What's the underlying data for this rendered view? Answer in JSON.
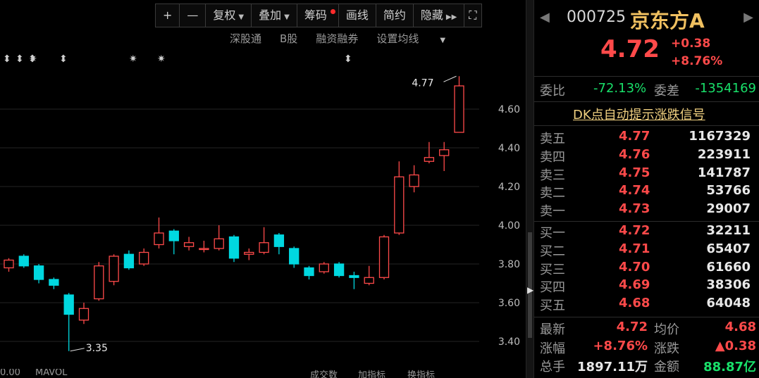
{
  "toolbar": {
    "items": [
      "+",
      "—",
      "复权",
      "叠加",
      "筹码",
      "画线",
      "简约",
      "隐藏"
    ],
    "expand_icon": "expand-icon"
  },
  "subbar": [
    "深股通",
    "B股",
    "融资融券",
    "设置均线"
  ],
  "chart_data": {
    "type": "candlestick",
    "y_ticks": [
      "4.60",
      "4.40",
      "4.20",
      "4.00",
      "3.80",
      "3.60",
      "3.40"
    ],
    "ylim": [
      3.3,
      4.8
    ],
    "candles": [
      {
        "o": 3.78,
        "c": 3.82,
        "h": 3.83,
        "l": 3.76
      },
      {
        "o": 3.84,
        "c": 3.79,
        "h": 3.85,
        "l": 3.78
      },
      {
        "o": 3.79,
        "c": 3.72,
        "h": 3.8,
        "l": 3.7
      },
      {
        "o": 3.72,
        "c": 3.69,
        "h": 3.73,
        "l": 3.67
      },
      {
        "o": 3.64,
        "c": 3.54,
        "h": 3.65,
        "l": 3.35
      },
      {
        "o": 3.51,
        "c": 3.57,
        "h": 3.6,
        "l": 3.49
      },
      {
        "o": 3.62,
        "c": 3.79,
        "h": 3.81,
        "l": 3.61
      },
      {
        "o": 3.71,
        "c": 3.84,
        "h": 3.85,
        "l": 3.69
      },
      {
        "o": 3.85,
        "c": 3.78,
        "h": 3.87,
        "l": 3.77
      },
      {
        "o": 3.8,
        "c": 3.86,
        "h": 3.88,
        "l": 3.79
      },
      {
        "o": 3.9,
        "c": 3.96,
        "h": 4.04,
        "l": 3.88
      },
      {
        "o": 3.97,
        "c": 3.92,
        "h": 3.98,
        "l": 3.85
      },
      {
        "o": 3.89,
        "c": 3.91,
        "h": 3.94,
        "l": 3.87
      },
      {
        "o": 3.88,
        "c": 3.88,
        "h": 3.92,
        "l": 3.86
      },
      {
        "o": 3.88,
        "c": 3.93,
        "h": 4.0,
        "l": 3.87
      },
      {
        "o": 3.94,
        "c": 3.83,
        "h": 3.95,
        "l": 3.81
      },
      {
        "o": 3.85,
        "c": 3.86,
        "h": 3.88,
        "l": 3.82
      },
      {
        "o": 3.86,
        "c": 3.91,
        "h": 3.99,
        "l": 3.85
      },
      {
        "o": 3.95,
        "c": 3.89,
        "h": 3.96,
        "l": 3.85
      },
      {
        "o": 3.88,
        "c": 3.8,
        "h": 3.89,
        "l": 3.78
      },
      {
        "o": 3.78,
        "c": 3.74,
        "h": 3.79,
        "l": 3.72
      },
      {
        "o": 3.76,
        "c": 3.8,
        "h": 3.81,
        "l": 3.75
      },
      {
        "o": 3.8,
        "c": 3.74,
        "h": 3.81,
        "l": 3.73
      },
      {
        "o": 3.74,
        "c": 3.73,
        "h": 3.76,
        "l": 3.67
      },
      {
        "o": 3.7,
        "c": 3.73,
        "h": 3.79,
        "l": 3.69
      },
      {
        "o": 3.73,
        "c": 3.94,
        "h": 3.95,
        "l": 3.72
      },
      {
        "o": 3.96,
        "c": 4.25,
        "h": 4.33,
        "l": 3.95
      },
      {
        "o": 4.2,
        "c": 4.26,
        "h": 4.31,
        "l": 4.17
      },
      {
        "o": 4.33,
        "c": 4.35,
        "h": 4.43,
        "l": 4.32
      },
      {
        "o": 4.36,
        "c": 4.39,
        "h": 4.43,
        "l": 4.28
      },
      {
        "o": 4.48,
        "c": 4.72,
        "h": 4.77,
        "l": 4.48
      }
    ],
    "high_label": "4.77",
    "low_label": "3.35",
    "colors": {
      "up": "#ff4a4a",
      "down": "#00d8e0",
      "grid": "#232323"
    }
  },
  "event_marks": [
    "⬍",
    "⬍",
    "⬍",
    "✷",
    "⬍",
    "✷",
    "✷",
    "⬍"
  ],
  "bottom_strip": [
    "0.00",
    "MAVOL",
    "成交数",
    "加指标",
    "换指标"
  ],
  "quote": {
    "code": "000725",
    "name": "京东方A",
    "price": "4.72",
    "change": "+0.38",
    "change_pct": "+8.76%",
    "ratio_label": "委比",
    "ratio_value": "-72.13%",
    "diff_label": "委差",
    "diff_value": "-1354169",
    "signal_text": "DK点自动提示涨跌信号",
    "asks": [
      {
        "label": "卖五",
        "price": "4.77",
        "vol": "1167329"
      },
      {
        "label": "卖四",
        "price": "4.76",
        "vol": "223911"
      },
      {
        "label": "卖三",
        "price": "4.75",
        "vol": "141787"
      },
      {
        "label": "卖二",
        "price": "4.74",
        "vol": "53766"
      },
      {
        "label": "卖一",
        "price": "4.73",
        "vol": "29007"
      }
    ],
    "bids": [
      {
        "label": "买一",
        "price": "4.72",
        "vol": "32211"
      },
      {
        "label": "买二",
        "price": "4.71",
        "vol": "65407"
      },
      {
        "label": "买三",
        "price": "4.70",
        "vol": "61660"
      },
      {
        "label": "买四",
        "price": "4.69",
        "vol": "38306"
      },
      {
        "label": "买五",
        "price": "4.68",
        "vol": "64048"
      }
    ],
    "stats": [
      {
        "l1": "最新",
        "v1": "4.72",
        "l2": "均价",
        "v2": "4.68"
      },
      {
        "l1": "涨幅",
        "v1": "+8.76%",
        "l2": "涨跌",
        "v2": "▲0.38"
      },
      {
        "l1": "总手",
        "v1": "1897.11万",
        "l2": "金额",
        "v2": "88.87亿"
      }
    ]
  }
}
